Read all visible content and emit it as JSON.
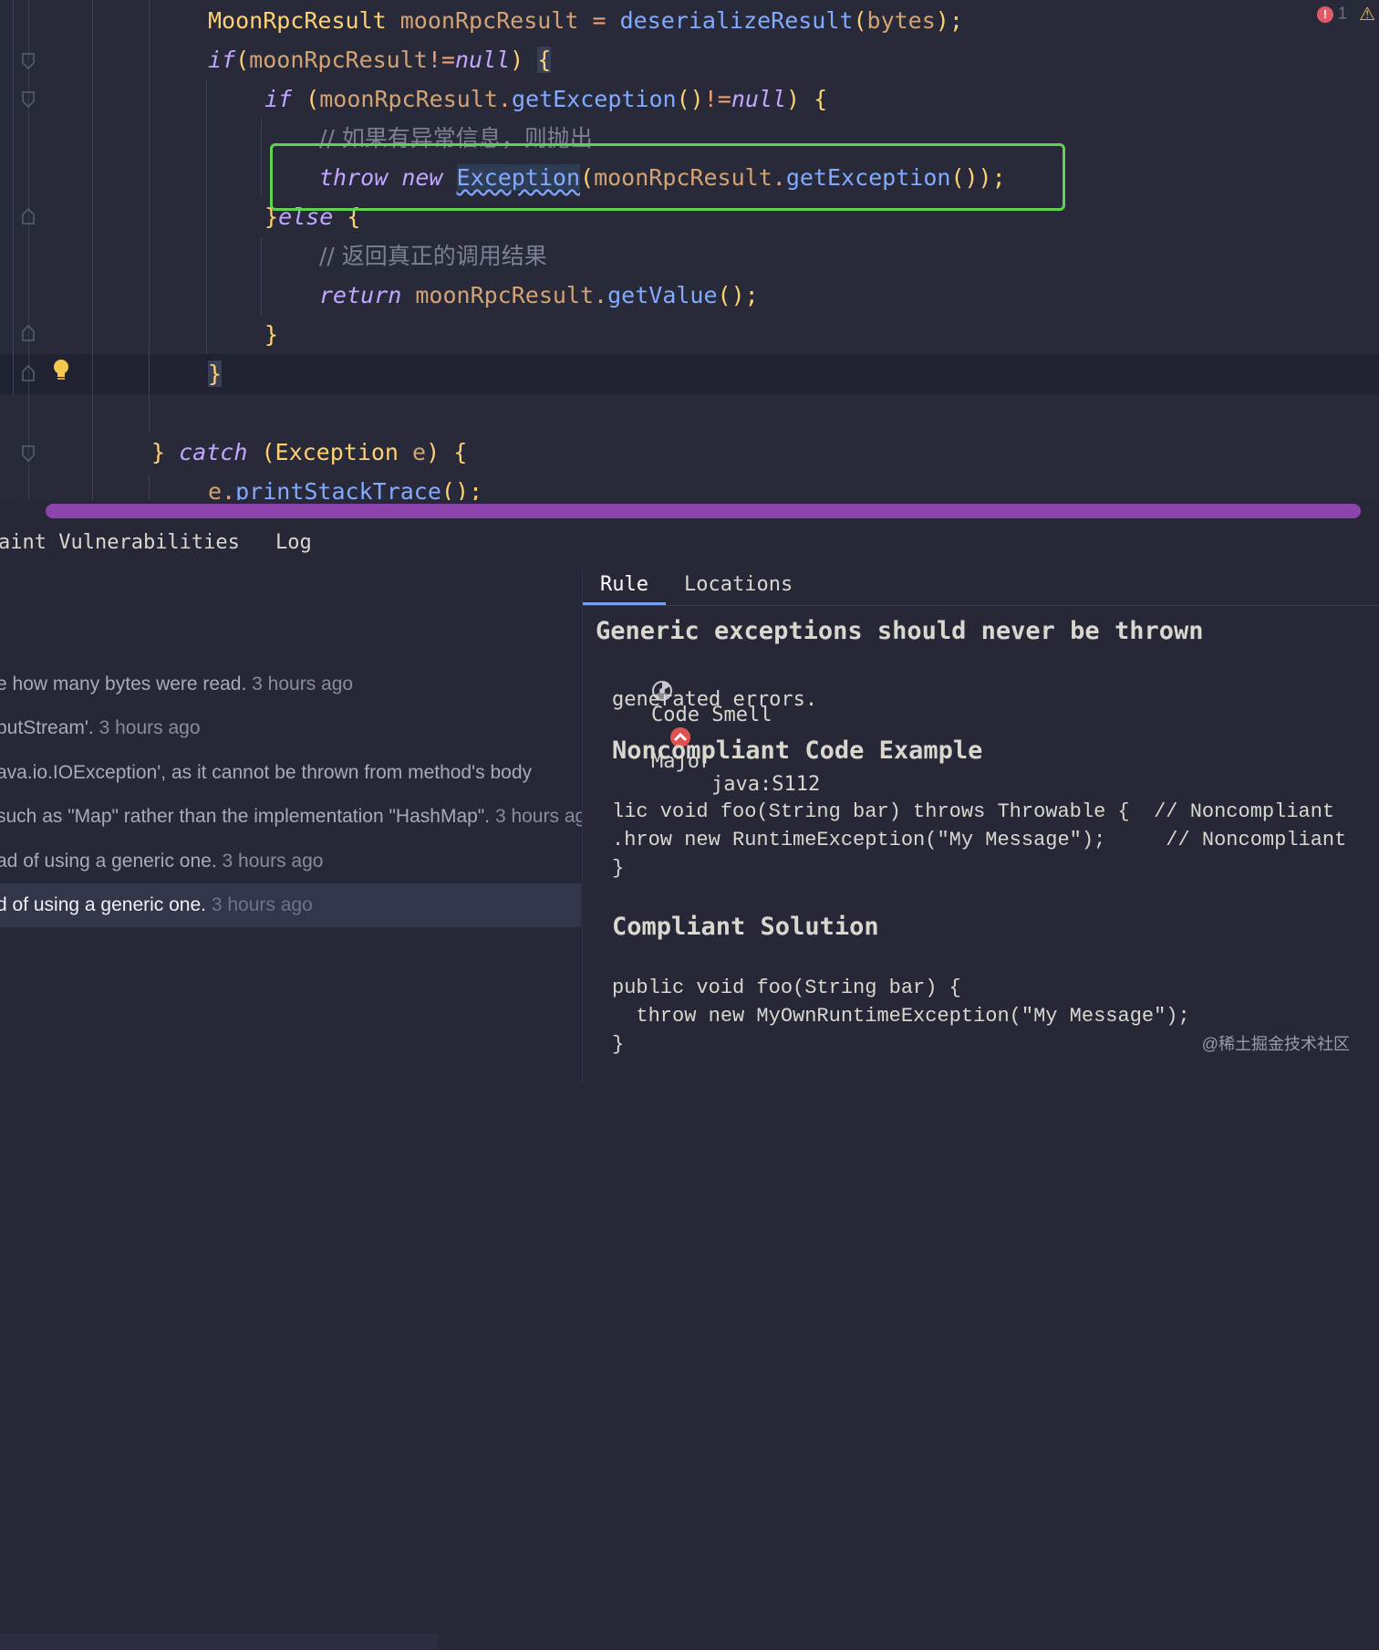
{
  "editor": {
    "lines": {
      "l1": {
        "type": "MoonRpcResult",
        "var": "moonRpcResult",
        "op": "=",
        "fn": "deserializeResult",
        "open": "(",
        "arg": "bytes",
        "close": ");"
      },
      "l2": {
        "kw": "if",
        "open": "(",
        "var": "moonRpcResult",
        "op": "!=",
        "null": "null",
        "close": ")",
        "brace": "{"
      },
      "l3": {
        "kw": "if",
        "open": "(",
        "var": "moonRpcResult",
        "dot": ".",
        "fn": "getException",
        "call": "()",
        "op": "!=",
        "null": "null",
        "close": ")",
        "brace": "{"
      },
      "l4": {
        "comment": "// 如果有异常信息，则抛出"
      },
      "l5": {
        "kw_throw": "throw",
        "kw_new": "new",
        "exc": "Exception",
        "open": "(",
        "var": "moonRpcResult",
        "dot": ".",
        "fn": "getException",
        "close": "());"
      },
      "l6": {
        "brace": "}",
        "kw": "else",
        "brace2": "{"
      },
      "l7": {
        "comment": "// 返回真正的调用结果"
      },
      "l8": {
        "kw": "return",
        "var": "moonRpcResult",
        "dot": ".",
        "fn": "getValue",
        "close": "();"
      },
      "l9": {
        "brace": "}"
      },
      "l10": {
        "brace": "}"
      },
      "l11": {
        "brace": "}",
        "kw": "catch",
        "open": "(",
        "type": "Exception",
        "var": "e",
        "close": ")",
        "brace2": "{"
      },
      "l12": {
        "var": "e",
        "dot": ".",
        "fn": "printStackTrace",
        "close": "();"
      }
    },
    "error_count": "1",
    "colors": {
      "highlight_box": "#5fd34f",
      "scrollbar": "#8e44ad"
    }
  },
  "bottom_tabs": {
    "taint": "aint Vulnerabilities",
    "log": "Log"
  },
  "issues": [
    {
      "text": "e how many bytes were read.",
      "ago": "3 hours ago"
    },
    {
      "text": "putStream'.",
      "ago": "3 hours ago"
    },
    {
      "text": "ava.io.IOException', as it cannot be thrown from method's body",
      "ago": ""
    },
    {
      "text": "such as \"Map\" rather than the implementation \"HashMap\".",
      "ago": "3 hours ago"
    },
    {
      "text": "ad of using a generic one.",
      "ago": "3 hours ago"
    },
    {
      "text": "d of using a generic one.",
      "ago": "3 hours ago"
    }
  ],
  "rule": {
    "tabs": {
      "rule": "Rule",
      "locations": "Locations"
    },
    "title": "Generic exceptions should never be thrown",
    "type": "Code Smell",
    "severity": "Major",
    "key": "java:S112",
    "desc_tail": "generated errors.",
    "noncompliant_heading": "Noncompliant Code Example",
    "noncompliant_code": "lic void foo(String bar) throws Throwable {  // Noncompliant\n.hrow new RuntimeException(\"My Message\");     // Noncompliant\n}",
    "compliant_heading": "Compliant Solution",
    "compliant_code": "public void foo(String bar) {\n  throw new MyOwnRuntimeException(\"My Message\");\n}"
  },
  "watermark": "@稀土掘金技术社区"
}
